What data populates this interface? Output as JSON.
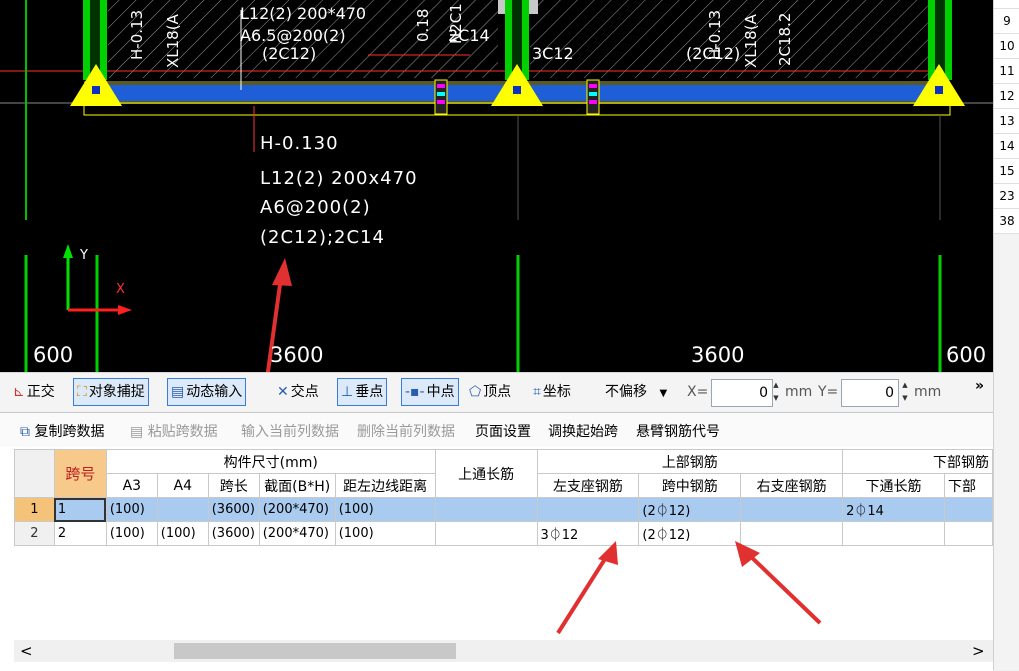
{
  "cad": {
    "annotation_top": [
      "L12(2) 200*470",
      "A6.5@200(2)",
      "(2C12)"
    ],
    "annotation_top_right": "2C14",
    "annotation_3c12": "3C12",
    "annotation_2c12_right": "(2C12)",
    "vert_labels": [
      "H-0.13",
      "XL18(A",
      "0.18",
      "N2C1",
      "H-0.13",
      "XL18(A",
      "2C18.2"
    ],
    "label_lines": [
      "H-0.130",
      "L12(2) 200x470",
      "A6@200(2)",
      "(2C12);2C14"
    ],
    "axis_y": "Y",
    "axis_x": "X",
    "dims": [
      "600",
      "3600",
      "3600",
      "600"
    ]
  },
  "right_rows": [
    "9",
    "10",
    "11",
    "12",
    "13",
    "14",
    "15",
    "23",
    "38"
  ],
  "snap_toolbar": {
    "ortho": "正交",
    "object_snap": "对象捕捉",
    "dynamic_input": "动态输入",
    "intersection": "交点",
    "perpendicular": "垂点",
    "midpoint": "中点",
    "vertex": "顶点",
    "coordinate": "坐标",
    "offset_mode": "不偏移",
    "x_label": "X=",
    "x_value": "0",
    "y_label": "Y=",
    "y_value": "0",
    "unit": "mm",
    "more": "»"
  },
  "grid_toolbar": {
    "copy_span": "复制跨数据",
    "paste_span": "粘贴跨数据",
    "input_col": "输入当前列数据",
    "delete_col": "删除当前列数据",
    "page_setup": "页面设置",
    "swap_start": "调换起始跨",
    "cantilever_code": "悬臂钢筋代号"
  },
  "table": {
    "span_header": "跨号",
    "size_group": "构件尺寸(mm)",
    "size_cols": [
      "A3",
      "A4",
      "跨长",
      "截面(B*H)",
      "距左边线距离"
    ],
    "top_through": "上通长筋",
    "top_group": "上部钢筋",
    "top_cols": [
      "左支座钢筋",
      "跨中钢筋",
      "右支座钢筋"
    ],
    "bottom_group": "下部钢筋",
    "bottom_cols": [
      "下通长筋",
      "下部"
    ],
    "rows": [
      {
        "num": "1",
        "span": "1",
        "a3": "(100)",
        "a4": "",
        "len": "(3600)",
        "sec": "(200*470)",
        "dist": "(100)",
        "top_through": "",
        "left": "",
        "mid": "(2⏀12)",
        "right": "",
        "bot_through": "2⏀14",
        "bot": ""
      },
      {
        "num": "2",
        "span": "2",
        "a3": "(100)",
        "a4": "(100)",
        "len": "(3600)",
        "sec": "(200*470)",
        "dist": "(100)",
        "top_through": "",
        "left": "3⏀12",
        "mid": "(2⏀12)",
        "right": "",
        "bot_through": "",
        "bot": ""
      }
    ]
  },
  "scroll": {
    "left": "<",
    "right": ">"
  }
}
